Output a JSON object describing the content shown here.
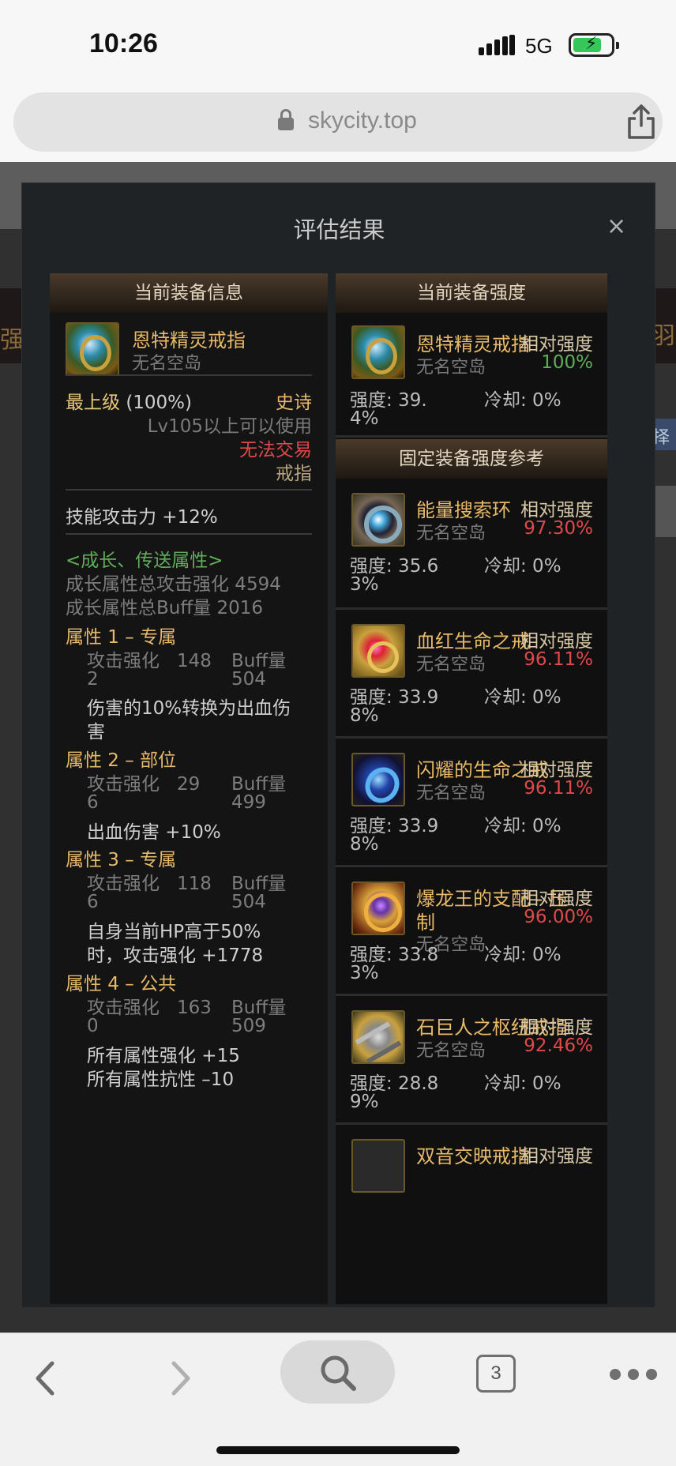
{
  "status_bar": {
    "time": "10:26",
    "network": "5G"
  },
  "browser": {
    "url": "skycity.top",
    "tab_count": "3"
  },
  "background_page": {
    "left_fragment": "强度",
    "right_fragment": "羽",
    "right_button": "择"
  },
  "modal": {
    "title": "评估结果",
    "close_label": "×",
    "left_panel": {
      "header": "当前装备信息",
      "item": {
        "name": "恩特精灵戒指",
        "source": "无名空岛"
      },
      "grade": "最上级",
      "grade_pct": "(100%)",
      "rarity": "史诗",
      "level_req": "Lv105以上可以使用",
      "trade": "无法交易",
      "slot": "戒指",
      "skill_attack": "技能攻击力  +12%",
      "growth_title": "<成长、传送属性>",
      "growth_total_attack": "成长属性总攻击强化 4594",
      "growth_total_buff": "成长属性总Buff量 2016",
      "attributes": [
        {
          "title": "属性 1 – 专属",
          "atk_label": "攻击强化",
          "atk_line1": "148",
          "atk_line2": "2",
          "buff_label": "Buff量",
          "buff_value": "504",
          "effect_lines": [
            "伤害的10%转换为出血伤",
            "害"
          ]
        },
        {
          "title": "属性 2 – 部位",
          "atk_label": "攻击强化",
          "atk_line1": "29",
          "atk_line2": "6",
          "buff_label": "Buff量",
          "buff_value": "499",
          "effect_lines": [
            "出血伤害 +10%"
          ]
        },
        {
          "title": "属性 3 – 专属",
          "atk_label": "攻击强化",
          "atk_line1": "118",
          "atk_line2": "6",
          "buff_label": "Buff量",
          "buff_value": "504",
          "effect_lines": [
            "自身当前HP高于50%",
            "时，攻击强化 +1778"
          ]
        },
        {
          "title": "属性 4 – 公共",
          "atk_label": "攻击强化",
          "atk_line1": "163",
          "atk_line2": "0",
          "buff_label": "Buff量",
          "buff_value": "509",
          "effect_lines": [
            "所有属性强化 +15",
            "所有属性抗性 –10"
          ]
        }
      ]
    },
    "right_panel": {
      "header": "当前装备强度",
      "current": {
        "name": "恩特精灵戒指",
        "source": "无名空岛",
        "rel_label": "相对强度",
        "rel_value": "100%",
        "strength_line1": "强度: 39.",
        "strength_line2": "4%",
        "cooldown": "冷却: 0%"
      },
      "reference_header": "固定装备强度参考",
      "references": [
        {
          "name": "能量搜索环",
          "name2": "",
          "source": "无名空岛",
          "rel_label": "相对强度",
          "rel_value": "97.30%",
          "strength_line1": "强度: 35.6",
          "strength_line2": "3%",
          "cooldown": "冷却: 0%"
        },
        {
          "name": "血红生命之戒",
          "name2": "",
          "source": "无名空岛",
          "rel_label": "相对强度",
          "rel_value": "96.11%",
          "strength_line1": "强度: 33.9",
          "strength_line2": "8%",
          "cooldown": "冷却: 0%"
        },
        {
          "name": "闪耀的生命之戒",
          "name2": "",
          "source": "无名空岛",
          "rel_label": "相对强度",
          "rel_value": "96.11%",
          "strength_line1": "强度: 33.9",
          "strength_line2": "8%",
          "cooldown": "冷却: 0%"
        },
        {
          "name": "爆龙王的支配 - 压",
          "name2": "制",
          "source": "无名空岛",
          "rel_label": "相对强度",
          "rel_value": "96.00%",
          "strength_line1": "强度: 33.8",
          "strength_line2": "3%",
          "cooldown": "冷却: 0%"
        },
        {
          "name": "石巨人之枢纽戒指",
          "name2": "",
          "source": "无名空岛",
          "rel_label": "相对强度",
          "rel_value": "92.46%",
          "strength_line1": "强度: 28.8",
          "strength_line2": "9%",
          "cooldown": "冷却: 0%"
        },
        {
          "name": "双音交映戒指",
          "name2": "",
          "source": "",
          "rel_label": "相对强度",
          "rel_value": "",
          "strength_line1": "",
          "strength_line2": "",
          "cooldown": ""
        }
      ]
    }
  },
  "colors": {
    "gold": "#e7b968",
    "green": "#5fae5a",
    "red": "#e0494a",
    "panel_bg": "#141414",
    "modal_bg": "#1f2326"
  }
}
